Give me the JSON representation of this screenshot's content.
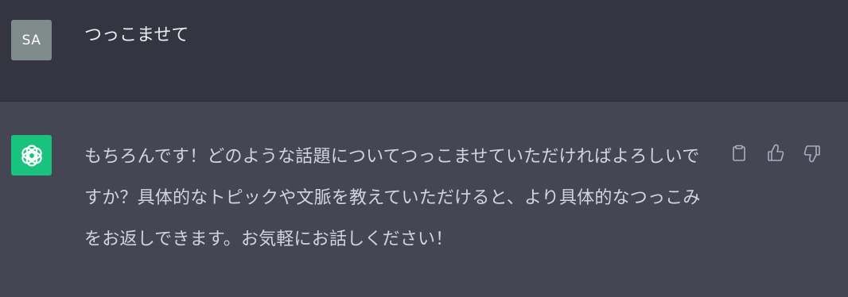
{
  "user_message": {
    "avatar_initials": "SA",
    "text": "つっこませて"
  },
  "assistant_message": {
    "avatar_icon": "openai-logo-icon",
    "text": "もちろんです！どのような話題についてつっこませていただければよろしいですか？具体的なトピックや文脈を教えていただけると、より具体的なつっこみをお返しできます。お気軽にお話しください！"
  },
  "actions": {
    "copy_icon": "clipboard-icon",
    "like_icon": "thumbs-up-icon",
    "dislike_icon": "thumbs-down-icon"
  },
  "colors": {
    "user_bg": "#343541",
    "assistant_bg": "#444654",
    "bot_avatar": "#19c37d",
    "user_avatar": "#7f8c8b",
    "text": "#d1d5db",
    "icon": "#acacbe"
  }
}
